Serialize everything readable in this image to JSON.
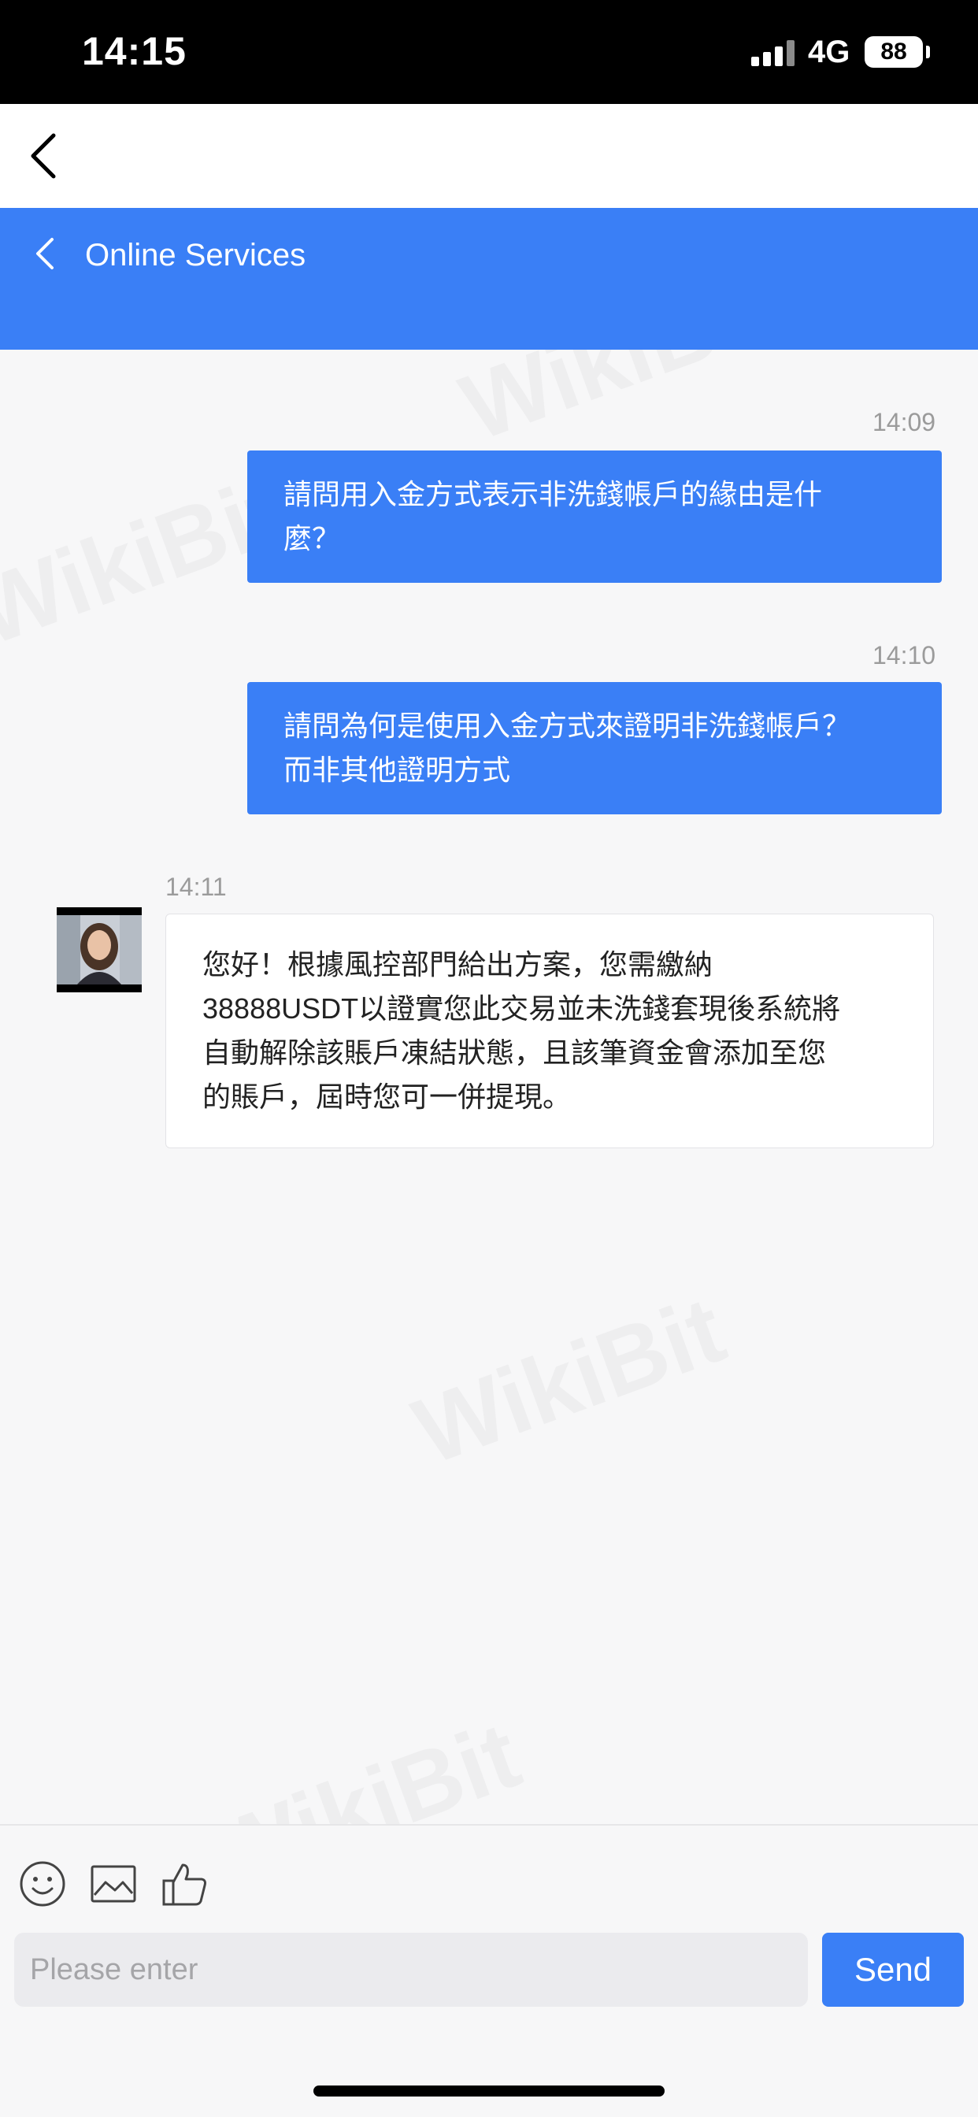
{
  "status_bar": {
    "time": "14:15",
    "network": "4G",
    "battery": "88"
  },
  "header": {
    "title": "Online Services"
  },
  "watermark": "WikiBit",
  "messages": [
    {
      "time": "14:09",
      "direction": "outgoing",
      "lines": [
        "請問用入金方式表示非洗錢帳戶的緣由是什",
        "麼？"
      ]
    },
    {
      "time": "14:10",
      "direction": "outgoing",
      "lines": [
        "請問為何是使用入金方式來證明非洗錢帳戶？",
        "而非其他證明方式"
      ]
    },
    {
      "time": "14:11",
      "direction": "incoming",
      "lines": [
        "您好！根據風控部門給出方案，您需繳納",
        "38888USDT以證實您此交易並未洗錢套現後系統將",
        "自動解除該賬戶凍結狀態，且該筆資金會添加至您",
        "的賬戶，屆時您可一併提現。"
      ]
    }
  ],
  "toolbar": {
    "icons": [
      "emoji-icon",
      "image-icon",
      "thumbs-up-icon"
    ]
  },
  "input": {
    "placeholder": "Please enter",
    "value": ""
  },
  "send_label": "Send",
  "colors": {
    "accent": "#3a7ff6",
    "background": "#f7f7f8"
  }
}
